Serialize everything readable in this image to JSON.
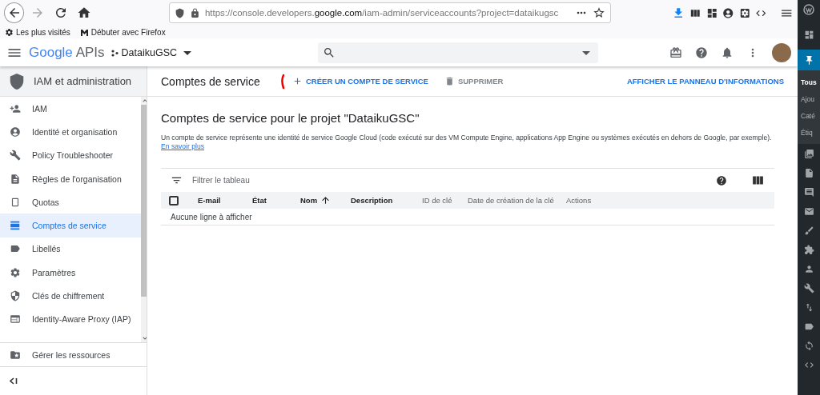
{
  "browser": {
    "url_start": "https://console.developers.",
    "url_domain": "google.com",
    "url_end": "/iam-admin/serviceaccounts?project=dataikugsc",
    "bookmarks": [
      {
        "label": "Les plus visités",
        "kind": "gear"
      },
      {
        "label": "Débuter avec Firefox",
        "kind": "m"
      }
    ]
  },
  "header": {
    "logo_brand": "Google",
    "logo_product": "APIs",
    "project": "DataikuGSC"
  },
  "sidebar": {
    "title": "IAM et administration",
    "items": [
      {
        "label": "IAM",
        "selected": false
      },
      {
        "label": "Identité et organisation",
        "selected": false
      },
      {
        "label": "Policy Troubleshooter",
        "selected": false
      },
      {
        "label": "Règles de l'organisation",
        "selected": false
      },
      {
        "label": "Quotas",
        "selected": false
      },
      {
        "label": "Comptes de service",
        "selected": true
      },
      {
        "label": "Libellés",
        "selected": false
      },
      {
        "label": "Paramètres",
        "selected": false
      },
      {
        "label": "Clés de chiffrement",
        "selected": false
      },
      {
        "label": "Identity-Aware Proxy (IAP)",
        "selected": false
      }
    ],
    "footer_item": "Gérer les ressources"
  },
  "toolbar": {
    "title": "Comptes de service",
    "actions": [
      {
        "label": "CRÉER UN COMPTE DE SERVICE",
        "kind": "create",
        "disabled": false
      },
      {
        "label": "SUPPRIMER",
        "kind": "delete",
        "disabled": true
      }
    ],
    "info_link": "AFFICHER LE PANNEAU D'INFORMATIONS"
  },
  "content": {
    "heading": "Comptes de service pour le projet \"DataikuGSC\"",
    "description": "Un compte de service représente une identité de service Google Cloud (code exécuté sur des VM Compute Engine, applications App Engine ou systèmes exécutés en dehors de Google, par exemple).",
    "learn_more": "En savoir plus"
  },
  "table": {
    "filter_placeholder": "Filtrer le tableau",
    "select_all": {
      "checked": false
    },
    "columns": [
      {
        "label": "E-mail",
        "sorted": false,
        "bold": true
      },
      {
        "label": "État",
        "sorted": false,
        "bold": true
      },
      {
        "label": "Nom",
        "sorted": true,
        "bold": true
      },
      {
        "label": "Description",
        "sorted": false,
        "bold": true
      },
      {
        "label": "ID de clé",
        "sorted": false,
        "bold": false
      },
      {
        "label": "Date de création de la clé",
        "sorted": false,
        "bold": false
      },
      {
        "label": "Actions",
        "sorted": false,
        "bold": false
      }
    ],
    "empty": "Aucune ligne à afficher"
  },
  "wp_menu": {
    "items": [
      {
        "label": "Tous",
        "selected": true
      },
      {
        "label": "Ajou",
        "selected": false
      },
      {
        "label": "Caté",
        "selected": false
      },
      {
        "label": "Étiq",
        "selected": false
      }
    ]
  }
}
